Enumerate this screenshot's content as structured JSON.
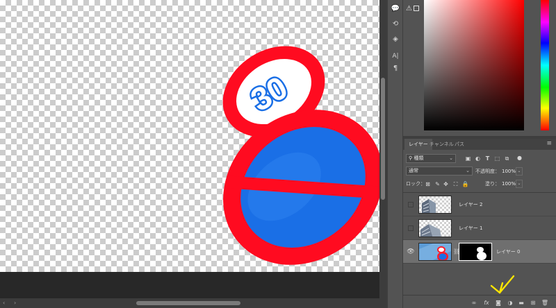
{
  "app": {
    "name": "Adobe Photoshop"
  },
  "canvas": {
    "sign_speed_limit_text": "30",
    "colors": {
      "sign_red": "#ff0b20",
      "sign_blue": "#1a6fe6",
      "checker": "#cccccc"
    }
  },
  "tool_strip": {
    "icons": [
      "comment-icon",
      "history-icon",
      "3d-icon",
      "character-icon",
      "paragraph-icon"
    ],
    "glyphs": [
      "💬",
      "⟲",
      "◈",
      "A|",
      "¶"
    ]
  },
  "color_panel": {
    "gamut_warning": "⚠",
    "accent": "#ff0000"
  },
  "layers_panel": {
    "tabs": [
      "レイヤー",
      "チャンネル",
      "パス"
    ],
    "active_tab": 0,
    "filter": {
      "label": "種類",
      "icon": "search-icon"
    },
    "blend_mode": "通常",
    "opacity_label": "不透明度：",
    "opacity_value": "100%",
    "lock_label": "ロック：",
    "fill_label": "塗り：",
    "fill_value": "100%",
    "layers": [
      {
        "name": "レイヤー 2",
        "visible": false,
        "selected": false,
        "has_mask": false
      },
      {
        "name": "レイヤー 1",
        "visible": false,
        "selected": false,
        "has_mask": false
      },
      {
        "name": "レイヤー 0",
        "visible": true,
        "selected": true,
        "has_mask": true
      }
    ],
    "footer": {
      "fx_label": "fx",
      "buttons": [
        "link-layers-icon",
        "fx-icon",
        "add-mask-icon",
        "adjustment-layer-icon",
        "new-group-icon",
        "new-layer-icon",
        "trash-icon"
      ]
    }
  },
  "annotation": {
    "color": "#ffe600",
    "target": "add-mask-button"
  }
}
